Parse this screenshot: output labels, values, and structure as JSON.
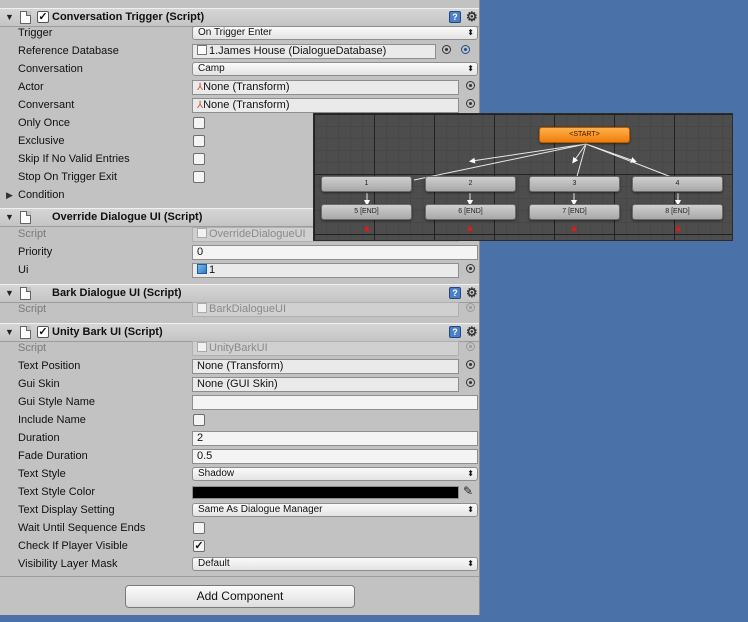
{
  "conversation_trigger": {
    "title": "Conversation Trigger (Script)",
    "enabled": true,
    "fields": {
      "trigger": {
        "label": "Trigger",
        "value": "On Trigger Enter"
      },
      "reference_database": {
        "label": "Reference Database",
        "value": "1.James House (DialogueDatabase)"
      },
      "conversation": {
        "label": "Conversation",
        "value": "Camp"
      },
      "actor": {
        "label": "Actor",
        "value": "None (Transform)"
      },
      "conversant": {
        "label": "Conversant",
        "value": "None (Transform)"
      },
      "only_once": {
        "label": "Only Once",
        "checked": false
      },
      "exclusive": {
        "label": "Exclusive",
        "checked": false
      },
      "skip_if_no_valid_entries": {
        "label": "Skip If No Valid Entries",
        "checked": false
      },
      "stop_on_trigger_exit": {
        "label": "Stop On Trigger Exit",
        "checked": false
      },
      "condition": {
        "label": "Condition"
      }
    }
  },
  "override_dialogue_ui": {
    "title": "Override Dialogue UI (Script)",
    "fields": {
      "script": {
        "label": "Script",
        "value": "OverrideDialogueUI"
      },
      "priority": {
        "label": "Priority",
        "value": "0"
      },
      "ui": {
        "label": "Ui",
        "value": "1"
      }
    }
  },
  "bark_dialogue_ui": {
    "title": "Bark Dialogue UI (Script)",
    "fields": {
      "script": {
        "label": "Script",
        "value": "BarkDialogueUI"
      }
    }
  },
  "unity_bark_ui": {
    "title": "Unity Bark UI (Script)",
    "enabled": true,
    "fields": {
      "script": {
        "label": "Script",
        "value": "UnityBarkUI"
      },
      "text_position": {
        "label": "Text Position",
        "value": "None (Transform)"
      },
      "gui_skin": {
        "label": "Gui Skin",
        "value": "None (GUI Skin)"
      },
      "gui_style_name": {
        "label": "Gui Style Name",
        "value": ""
      },
      "include_name": {
        "label": "Include Name",
        "checked": false
      },
      "duration": {
        "label": "Duration",
        "value": "2"
      },
      "fade_duration": {
        "label": "Fade Duration",
        "value": "0.5"
      },
      "text_style": {
        "label": "Text Style",
        "value": "Shadow"
      },
      "text_style_color": {
        "label": "Text Style Color",
        "color": "#000000"
      },
      "text_display_setting": {
        "label": "Text Display Setting",
        "value": "Same As Dialogue Manager"
      },
      "wait_until_sequence_ends": {
        "label": "Wait Until Sequence Ends",
        "checked": false
      },
      "check_if_player_visible": {
        "label": "Check If Player Visible",
        "checked": true
      },
      "visibility_layer_mask": {
        "label": "Visibility Layer Mask",
        "value": "Default"
      }
    }
  },
  "add_component_label": "Add Component",
  "dialogue_graph": {
    "start_label": "<START>",
    "nodes": [
      "1",
      "2",
      "3",
      "4"
    ],
    "end_nodes": [
      "5 [END]",
      "6 [END]",
      "7 [END]",
      "8 [END]"
    ],
    "colors": {
      "start": "#f28a1a",
      "node": "#bdbdbd",
      "end_marker": "#e01818"
    }
  },
  "icons": {
    "help": "help-book-icon",
    "settings": "gear-icon",
    "script": "script-file-icon",
    "transform": "transform-axes-icon",
    "prefab": "prefab-cube-icon",
    "picker": "object-picker-icon",
    "eyedropper": "eyedropper-icon"
  },
  "help_glyph": "?"
}
